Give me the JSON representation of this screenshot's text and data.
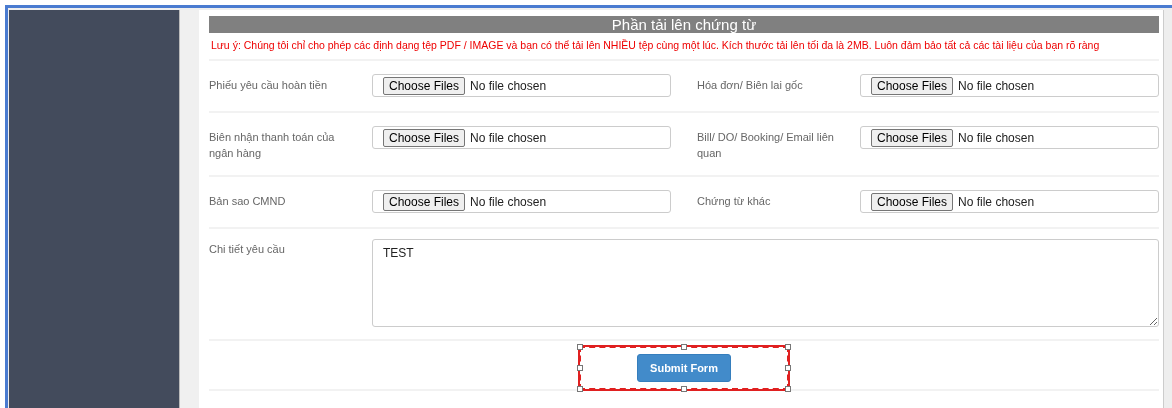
{
  "section": {
    "title": "Phần tải lên chứng từ",
    "note": "Lưu ý: Chúng tôi chỉ cho phép các định dạng tệp PDF / IMAGE và bạn có thể tải lên NHIỀU tệp cùng một lúc. Kích thước tải lên tối đa là 2MB. Luôn đảm bảo tất cả các tài liệu của bạn rõ ràng"
  },
  "upload_rows": [
    [
      {
        "label": "Phiếu yêu cầu hoàn tiền",
        "button": "Choose Files",
        "status": "No file chosen"
      },
      {
        "label": "Hóa đơn/ Biên lai gốc",
        "button": "Choose Files",
        "status": "No file chosen"
      }
    ],
    [
      {
        "label": "Biên nhận thanh toán của ngân hàng",
        "button": "Choose Files",
        "status": "No file chosen"
      },
      {
        "label": "Bill/ DO/ Booking/ Email liên quan",
        "button": "Choose Files",
        "status": "No file chosen"
      }
    ],
    [
      {
        "label": "Bản sao CMND",
        "button": "Choose Files",
        "status": "No file chosen"
      },
      {
        "label": "Chứng từ khác",
        "button": "Choose Files",
        "status": "No file chosen"
      }
    ]
  ],
  "details": {
    "label": "Chi tiết yêu cầu",
    "value": "TEST"
  },
  "submit": {
    "label": "Submit Form",
    "selected": true
  }
}
